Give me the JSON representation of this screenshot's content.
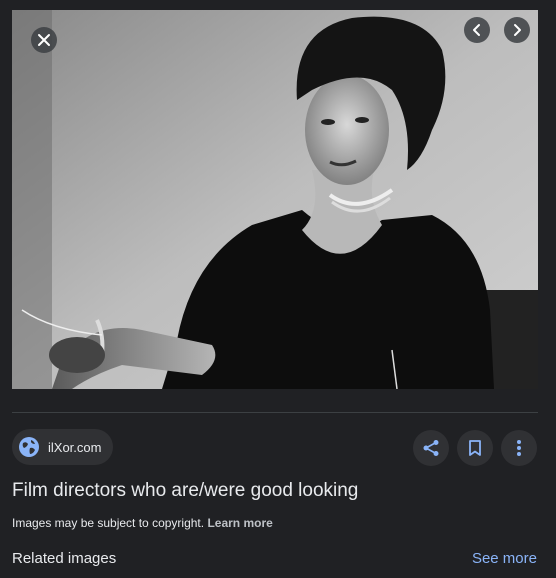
{
  "viewer": {
    "close_icon": "close-icon",
    "prev_icon": "chevron-left-icon",
    "next_icon": "chevron-right-icon"
  },
  "source": {
    "icon": "globe-icon",
    "label": "ilXor.com"
  },
  "actions": {
    "share_icon": "share-icon",
    "save_icon": "bookmark-icon",
    "more_icon": "more-vert-icon"
  },
  "title": "Film directors who are/were good looking",
  "copyright": {
    "text": "Images may be subject to copyright.",
    "link": "Learn more"
  },
  "related": {
    "heading": "Related images",
    "see_more": "See more"
  },
  "colors": {
    "background": "#202124",
    "chip": "#303134",
    "link_blue": "#8ab4f8",
    "accent_blue": "#8ab4f8"
  }
}
